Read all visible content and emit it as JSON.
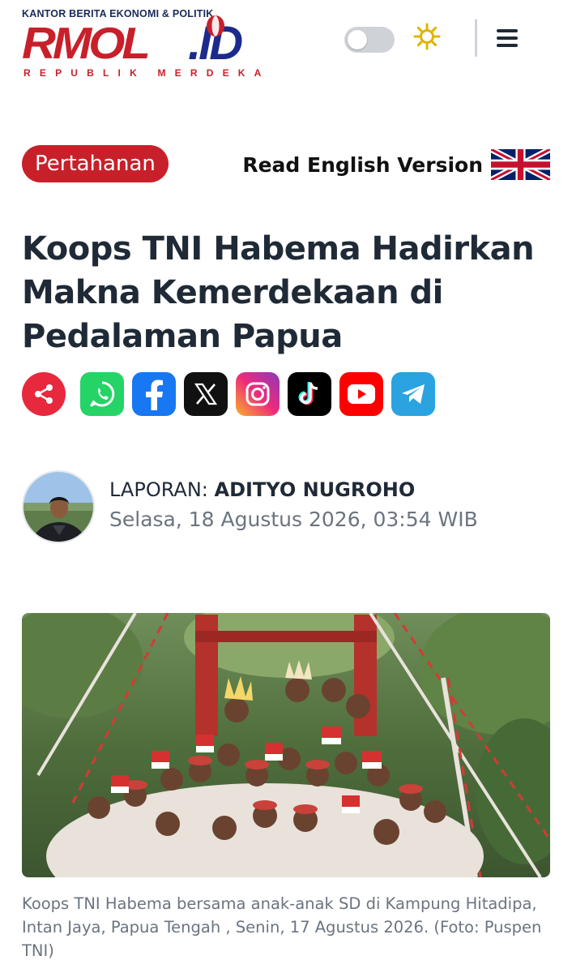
{
  "header": {
    "logo_tagline": "KANTOR BERITA EKONOMI & POLITIK",
    "logo_word1": "RMOL",
    "logo_word2": ".ID",
    "logo_subtitle": "REPUBLIK MERDEKA",
    "theme_toggle": "off",
    "icons": [
      "toggle-switch",
      "sun-icon",
      "hamburger-menu-icon"
    ]
  },
  "article": {
    "category": "Pertahanan",
    "english_link": "Read English Version",
    "title": "Koops TNI Habema Hadirkan Makna Kemerdekaan di Pedalaman Papua",
    "author_label": "LAPORAN: ",
    "author_name": "ADITYO NUGROHO",
    "published": "Selasa, 18 Agustus 2026, 03:54 WIB",
    "caption": "Koops TNI Habema bersama anak-anak SD di Kampung Hitadipa, Intan Jaya, Papua Tengah , Senin, 17 Agustus 2026. (Foto: Puspen TNI)"
  },
  "share": [
    "share-icon",
    "whatsapp-icon",
    "facebook-icon",
    "x-icon",
    "instagram-icon",
    "tiktok-icon",
    "youtube-icon",
    "telegram-icon"
  ],
  "colors": {
    "brand_red": "#c8202a",
    "brand_blue": "#1b2a8c",
    "text_dark": "#1f2a36",
    "text_muted": "#6b7480"
  }
}
